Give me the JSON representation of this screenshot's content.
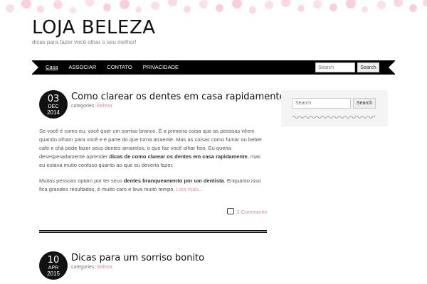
{
  "site": {
    "title": "LOJA BELEZA",
    "tagline": "dicas para fazer você olhar o seu melhor!"
  },
  "nav": {
    "items": [
      "Casa",
      "ASSOCIAR",
      "CONTATO",
      "PRIVACIDADE"
    ],
    "search_placeholder": "Search",
    "search_button": "Search"
  },
  "sidebar": {
    "search_placeholder": "Search",
    "search_button": "Search"
  },
  "colors": {
    "accent": "#e88a9e",
    "nav_bg": "#000000",
    "dots": "#f9c7d6"
  },
  "posts": [
    {
      "day": "03",
      "month": "DEC",
      "year": "2014",
      "title": "Como clarear os dentes em casa rapidamente",
      "categories_label": "categories:",
      "category": "Beleza",
      "p1_a": "Se você é como eu, você quer um sorriso branco. É a primeira coisa que as pessoas vêem quando olham para você e é parte do que torna atraente. Mas as coisas como fumar ou beber café e chá pode fazer seus dentes amarelos, o que faz você olhar feio. Eu queria desesperadamente aprender ",
      "p1_bold": "dicas de como clarear os dentes em casa rapidamente",
      "p1_b": ", mas eu estava muito confuso quanto ao que eu deveria fazer.",
      "p2_a": "Muitas pessoas optam por ter seus ",
      "p2_bold": "dentes branqueamento por um dentista",
      "p2_b": ". Enquanto isso fica grandes resultados, é muito caro e leva muito tempo. ",
      "read_more": "Leia mais...",
      "comments": "2 Comments"
    },
    {
      "day": "10",
      "month": "APR",
      "year": "2015",
      "title": "Dicas para um sorriso bonito",
      "categories_label": "categories:",
      "category": "Beleza"
    }
  ]
}
